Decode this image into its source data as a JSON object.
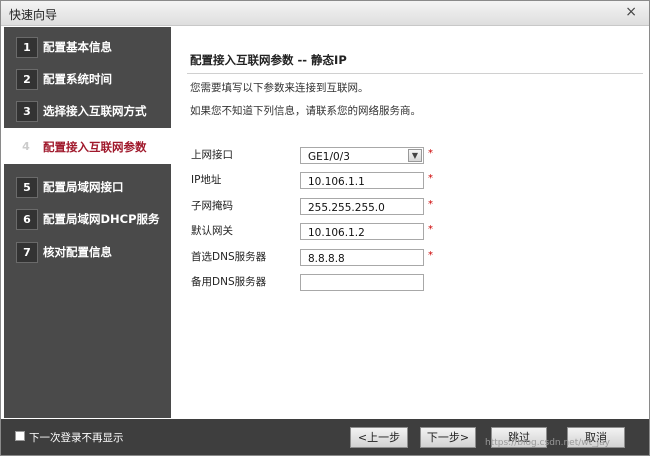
{
  "window": {
    "title": "快速向导",
    "close_glyph": "×"
  },
  "steps": [
    {
      "num": "1",
      "label": "配置基本信息",
      "active": false
    },
    {
      "num": "2",
      "label": "配置系统时间",
      "active": false
    },
    {
      "num": "3",
      "label": "选择接入互联网方式",
      "active": false
    },
    {
      "num": "4",
      "label": "配置接入互联网参数",
      "active": true
    },
    {
      "num": "5",
      "label": "配置局域网接口",
      "active": false
    },
    {
      "num": "6",
      "label": "配置局域网DHCP服务",
      "active": false
    },
    {
      "num": "7",
      "label": "核对配置信息",
      "active": false
    }
  ],
  "main": {
    "section_title": "配置接入互联网参数 -- 静态IP",
    "desc1": "您需要填写以下参数来连接到互联网。",
    "desc2": "如果您不知道下列信息，请联系您的网络服务商。",
    "required_mark": "*",
    "fields": {
      "uplink": {
        "label": "上网接口",
        "value": "GE1/0/3"
      },
      "ip": {
        "label": "IP地址",
        "value": "10.106.1.1"
      },
      "mask": {
        "label": "子网掩码",
        "value": "255.255.255.0"
      },
      "gateway": {
        "label": "默认网关",
        "value": "10.106.1.2"
      },
      "dns1": {
        "label": "首选DNS服务器",
        "value": "8.8.8.8"
      },
      "dns2": {
        "label": "备用DNS服务器",
        "value": ""
      }
    }
  },
  "footer": {
    "no_show_label": "下一次登录不再显示",
    "prev": "<上一步",
    "next": "下一步>",
    "skip": "跳过",
    "cancel": "取消",
    "watermark": "https://blog.csdn.net/wt_jay"
  },
  "icons": {
    "dropdown": "chevron-down-icon",
    "close": "close-icon"
  }
}
